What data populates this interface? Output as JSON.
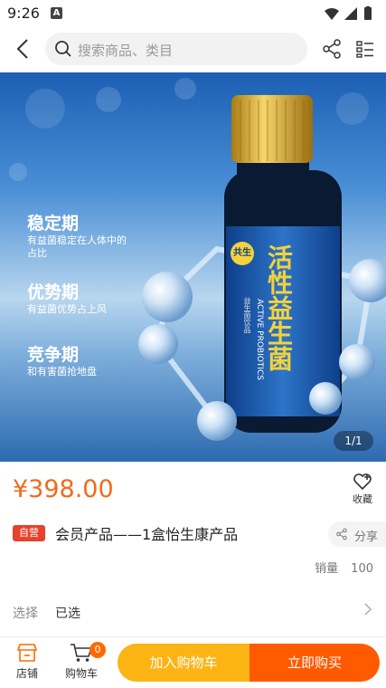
{
  "status_bar": {
    "time": "9:26",
    "notification_letter": "A"
  },
  "search": {
    "placeholder": "搜索商品、类目"
  },
  "hero": {
    "sections": [
      {
        "title": "稳定期",
        "desc_line1": "有益菌稳定在人体中的",
        "desc_line2": "占比"
      },
      {
        "title": "优势期",
        "desc_line1": "有益菌优势占上风"
      },
      {
        "title": "竞争期",
        "desc_line1": "和有害菌抢地盘"
      }
    ],
    "label_main": "活性益生菌",
    "label_en": "ACTIVE PROBIOTICS",
    "label_sub": "益生菌饮品",
    "label_logo": "共生",
    "page_counter": "1/1"
  },
  "product": {
    "price": "¥398.00",
    "favorite_label": "收藏",
    "badge": "自营",
    "title": "会员产品——1盒怡生康产品",
    "share_label": "分享",
    "sales_label": "销量",
    "sales_value": "100"
  },
  "selection": {
    "label": "选择",
    "value": "已选"
  },
  "bottom_bar": {
    "store_label": "店铺",
    "cart_label": "购物车",
    "cart_count": "0",
    "add_to_cart": "加入购物车",
    "buy_now": "立即购买"
  },
  "colors": {
    "price": "#f26a1b",
    "badge": "#e8412c",
    "cart_button": "#fcb314",
    "buy_button": "#ff5a00"
  }
}
